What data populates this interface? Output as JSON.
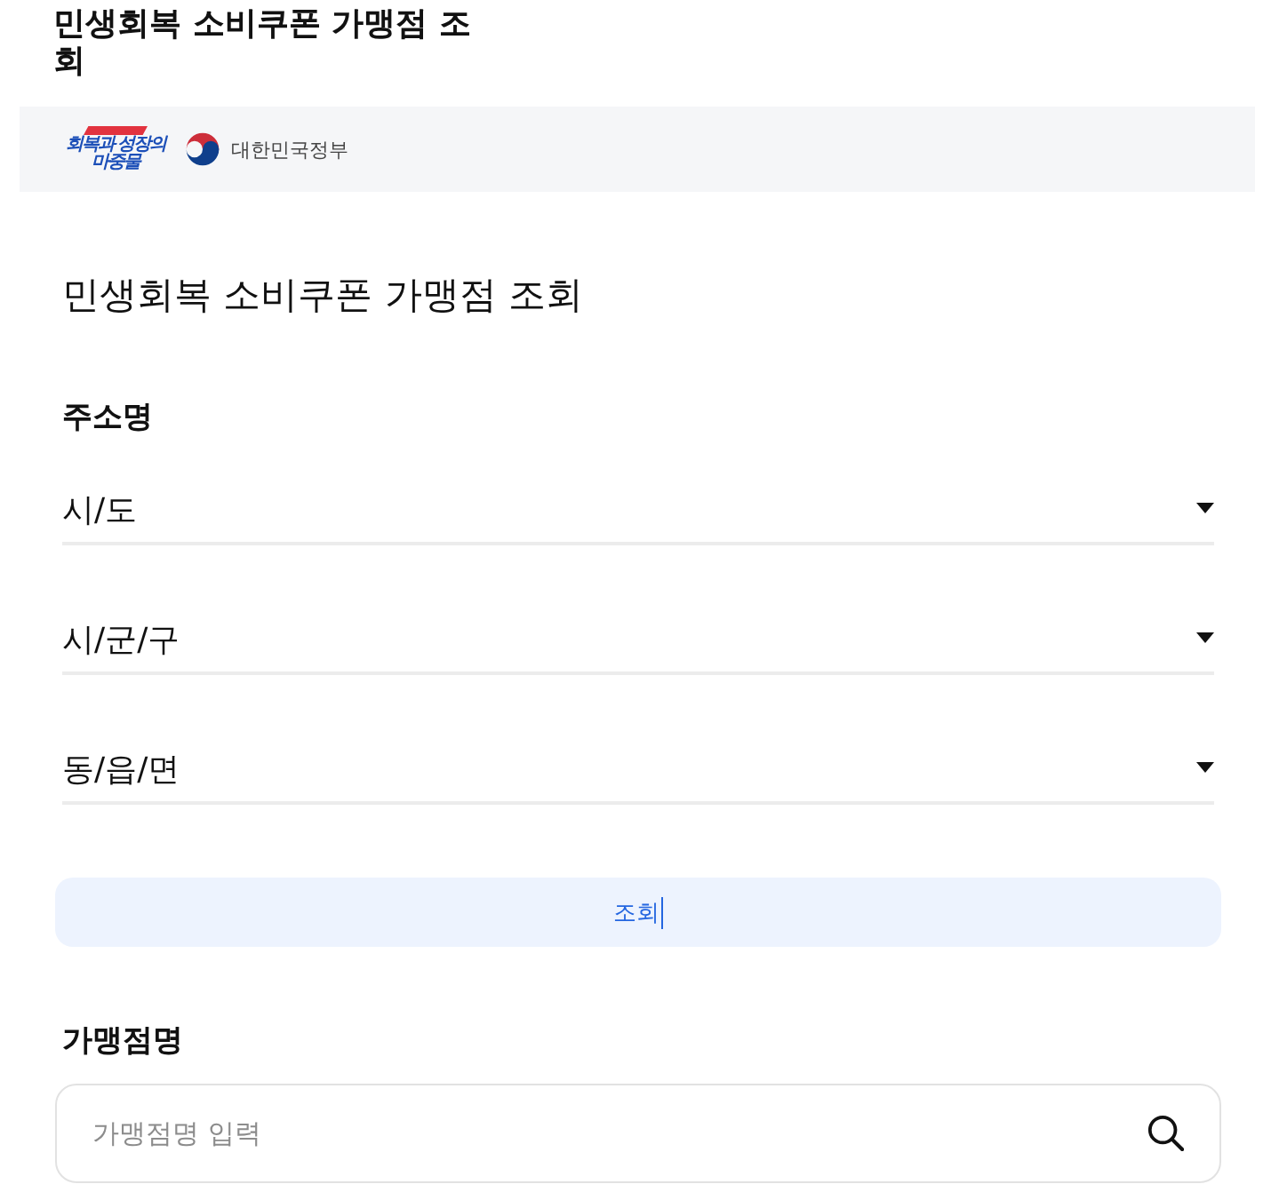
{
  "page_title": "민생회복 소비쿠폰 가맹점 조회",
  "banner": {
    "logo_lines": [
      "회복과 성장의",
      "마중물"
    ],
    "government_label": "대한민국정부"
  },
  "heading": "민생회복 소비쿠폰 가맹점 조회",
  "address_section": {
    "label": "주소명",
    "selects": [
      {
        "value": "시/도"
      },
      {
        "value": "시/군/구"
      },
      {
        "value": "동/읍/면"
      }
    ],
    "button": "조회"
  },
  "store_section": {
    "label": "가맹점명",
    "search": {
      "placeholder": "가맹점명 입력"
    }
  }
}
